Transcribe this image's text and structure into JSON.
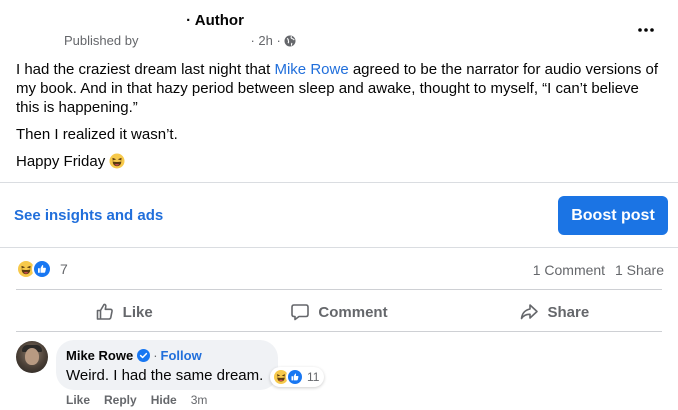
{
  "post": {
    "author_suffix": "· Author",
    "published_by": "Published by",
    "time": "· 2h ·",
    "paragraph1_before": "I had the craziest dream last night that ",
    "paragraph1_link": "Mike Rowe",
    "paragraph1_after": " agreed to be the narrator for audio versions of my book. And in that hazy period between sleep and awake, thought to myself, “I can’t believe this is happening.”",
    "paragraph2": "Then I realized it wasn’t.",
    "paragraph3": "Happy Friday"
  },
  "promo": {
    "insights_link": "See insights and ads",
    "boost_button": "Boost post"
  },
  "stats": {
    "reaction_count": "7",
    "comments": "1 Comment",
    "shares": "1 Share"
  },
  "actions": {
    "like": "Like",
    "comment": "Comment",
    "share": "Share"
  },
  "comment": {
    "name": "Mike Rowe",
    "separator": "·",
    "follow": "Follow",
    "text": "Weird. I had the same dream.",
    "reaction_count": "11",
    "like": "Like",
    "reply": "Reply",
    "hide": "Hide",
    "time": "3m"
  },
  "colors": {
    "link_blue": "#216fdb",
    "boost_blue": "#1b74e4",
    "secondary_text": "#65676b",
    "bubble_bg": "#f0f2f5"
  },
  "icons": [
    "more-icon",
    "globe-icon",
    "laugh-emoji-icon",
    "like-reaction-icon",
    "like-outline-icon",
    "comment-icon",
    "share-icon",
    "verified-icon"
  ]
}
